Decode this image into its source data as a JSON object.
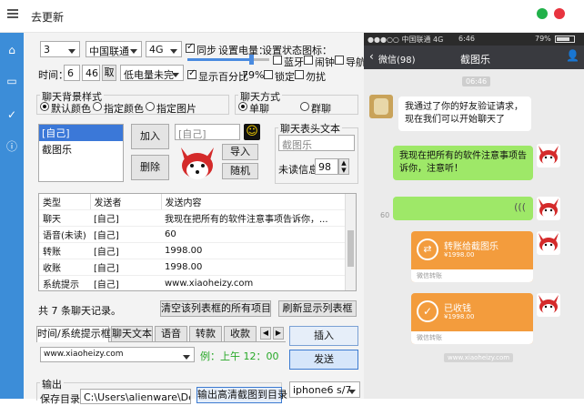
{
  "window": {
    "title": "去更新",
    "accent": "#3c8dd8"
  },
  "top": {
    "sim_count": "3",
    "carrier": "中国联通",
    "network": "4G",
    "sync_label": "同步",
    "battery_label": "设置电量：",
    "status_label": "设置状态图标：",
    "battery_percent_label": "显示百分比",
    "battery_value": "79%",
    "bluetooth": "蓝牙",
    "alarm": "闹钟",
    "nav": "导航",
    "lock": "锁定",
    "dnd": "勿扰",
    "time_label": "时间：",
    "hour": "6",
    "minute": "46",
    "take_label": "取",
    "low_power": "低电量未完"
  },
  "bg": {
    "title": "聊天背景样式",
    "opt1": "默认颜色",
    "opt2": "指定颜色",
    "opt3": "指定图片"
  },
  "mode": {
    "title": "聊天方式",
    "opt1": "单聊",
    "opt2": "群聊"
  },
  "people": {
    "list": [
      "[自己]",
      "截图乐"
    ],
    "add": "加入",
    "delete": "删除",
    "name_input": "[自己]",
    "import": "导入",
    "random": "随机"
  },
  "header_text": {
    "title": "聊天表头文本",
    "value": "截图乐",
    "unread_label": "未读信息",
    "unread_value": "98"
  },
  "table": {
    "columns": [
      "类型",
      "发送者",
      "发送内容"
    ],
    "rows": [
      [
        "聊天",
        "[自己]",
        "我现在把所有的软件注意事项告诉你，..."
      ],
      [
        "语音(未读)",
        "[自己]",
        "60"
      ],
      [
        "转账",
        "[自己]",
        "1998.00"
      ],
      [
        "收账",
        "[自己]",
        "1998.00"
      ],
      [
        "系统提示",
        "[自己]",
        "www.xiaoheizy.com"
      ]
    ]
  },
  "footer": {
    "count": "共 7 条聊天记录。",
    "clear": "清空该列表框的所有项目",
    "refresh": "刷新显示列表框"
  },
  "tabs": {
    "items": [
      "时间/系统提示框",
      "聊天文本",
      "语音",
      "转款",
      "收款"
    ],
    "input": "www.xiaoheizy.com",
    "example": "例：上午 12：00",
    "insert": "插入",
    "send": "发送"
  },
  "output": {
    "title": "输出",
    "path_label": "保存目录",
    "path": "C:\\Users\\alienware\\Deskt",
    "export": "输出高清截图到目录",
    "device": "iphone6 s/7"
  },
  "phone": {
    "status_carrier": "●●●○○ 中国联通  4G",
    "status_time": "6:46",
    "status_battery": "79%",
    "back": "微信(98)",
    "chat_title": "截图乐",
    "stamp": "06:46",
    "msg1": "我通过了你的好友验证请求，现在我们可以开始聊天了",
    "msg2": "我现在把所有的软件注意事项告诉你，注意听！",
    "voice_len": "60",
    "transfer_title": "转账给截图乐",
    "transfer_amount": "¥1998.00",
    "transfer_footer": "微信转账",
    "received_title": "已收钱",
    "received_amount": "¥1998.00",
    "received_footer": "微信转账",
    "system_tip": "www.xiaoheizy.com"
  }
}
